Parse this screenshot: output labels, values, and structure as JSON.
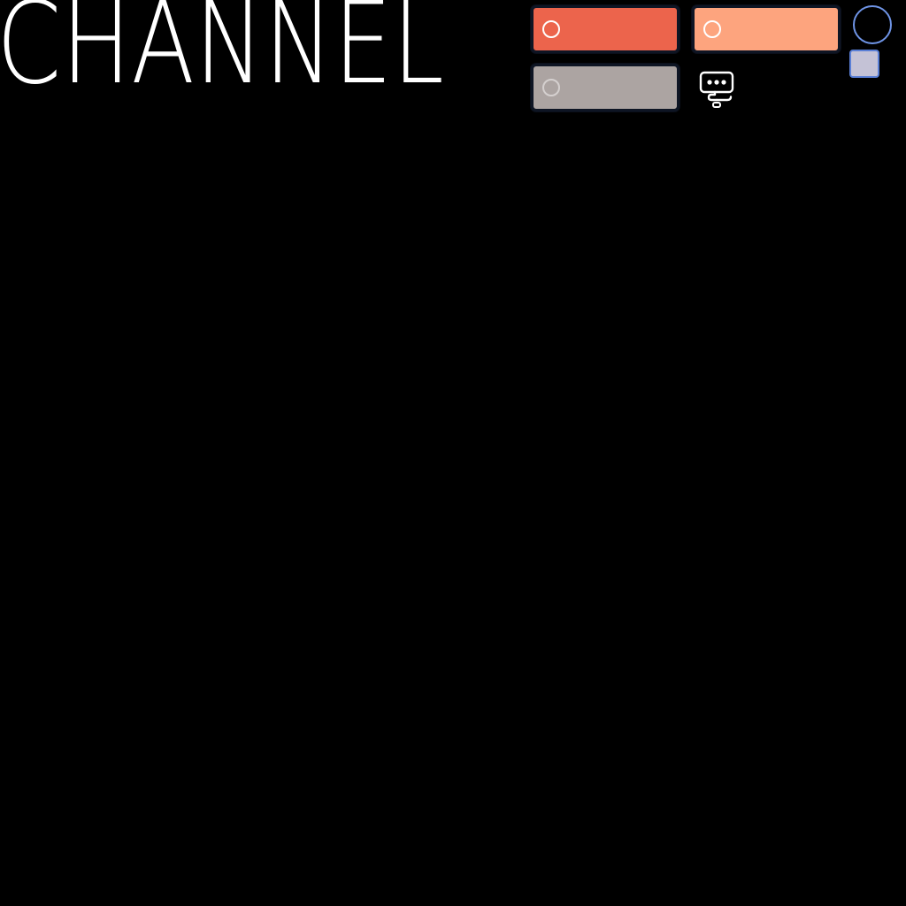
{
  "logo": {
    "text": "CHANNEL"
  },
  "swatches": [
    {
      "name": "swatch-red",
      "color": "#ec644c",
      "ring": "circle-outline-icon"
    },
    {
      "name": "swatch-peach",
      "color": "#fda47e",
      "ring": "circle-outline-icon"
    },
    {
      "name": "swatch-gray",
      "color": "#aca4a2",
      "ring": "circle-outline-icon"
    }
  ],
  "controls": {
    "circle_toggle_icon": "circle-outline-icon",
    "square_toggle_icon": "square-swatch-icon",
    "chat_icon": "chat-bubble-ellipsis-icon"
  },
  "colors": {
    "background": "#000000",
    "text": "#ffffff",
    "accent_blue": "#6f94e6",
    "square_fill": "#c4c2d6"
  }
}
